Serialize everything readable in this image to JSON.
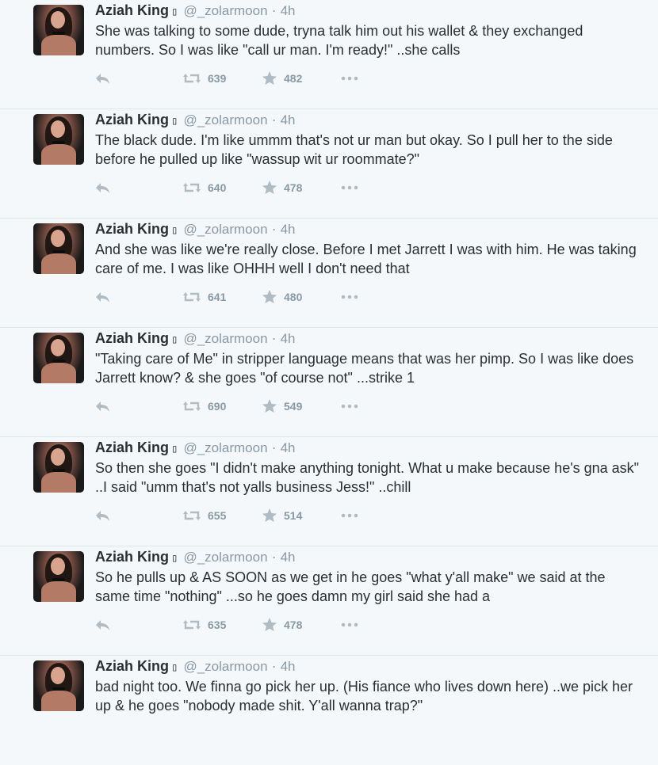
{
  "colors": {
    "background": "#f5f8fa",
    "text": "#292f33",
    "muted": "#8899a6",
    "divider": "#dfe6ea"
  },
  "tweets": [
    {
      "name": "Aziah King",
      "glyph": "▯",
      "handle": "@_zolarmoon",
      "sep": "·",
      "time": "4h",
      "text": "She was talking to some dude, tryna talk him out his wallet & they exchanged numbers. So I was like \"call ur man. I'm ready!\" ..she calls",
      "retweets": "639",
      "favorites": "482"
    },
    {
      "name": "Aziah King",
      "glyph": "▯",
      "handle": "@_zolarmoon",
      "sep": "·",
      "time": "4h",
      "text": "The black dude. I'm like ummm that's not ur man but okay. So I pull her to the side before he pulled up like \"wassup wit ur roommate?\"",
      "retweets": "640",
      "favorites": "478"
    },
    {
      "name": "Aziah King",
      "glyph": "▯",
      "handle": "@_zolarmoon",
      "sep": "·",
      "time": "4h",
      "text": "And she was like we're really close. Before I met Jarrett I was with him. He was taking care of me. I was like OHHH well I don't need that",
      "retweets": "641",
      "favorites": "480"
    },
    {
      "name": "Aziah King",
      "glyph": "▯",
      "handle": "@_zolarmoon",
      "sep": "·",
      "time": "4h",
      "text": "\"Taking care of Me\" in stripper language means that was her pimp. So I was like does Jarrett know? & she goes \"of course not\" ...strike 1",
      "retweets": "690",
      "favorites": "549"
    },
    {
      "name": "Aziah King",
      "glyph": "▯",
      "handle": "@_zolarmoon",
      "sep": "·",
      "time": "4h",
      "text": "So then she goes \"I didn't make anything tonight. What u make because he's gna ask\" ..I said \"umm that's not yalls business Jess!\" ..chill",
      "retweets": "655",
      "favorites": "514"
    },
    {
      "name": "Aziah King",
      "glyph": "▯",
      "handle": "@_zolarmoon",
      "sep": "·",
      "time": "4h",
      "text": "So he pulls up & AS SOON as we get in he goes \"what y'all make\" we said at the same time \"nothing\" ...so he goes damn my girl said she had a",
      "retweets": "635",
      "favorites": "478"
    },
    {
      "name": "Aziah King",
      "glyph": "▯",
      "handle": "@_zolarmoon",
      "sep": "·",
      "time": "4h",
      "text": "bad night too. We finna go pick her up. (His fiance who lives down here) ..we pick her up & he goes \"nobody made shit. Y'all wanna trap?\"",
      "retweets": "",
      "favorites": ""
    }
  ]
}
